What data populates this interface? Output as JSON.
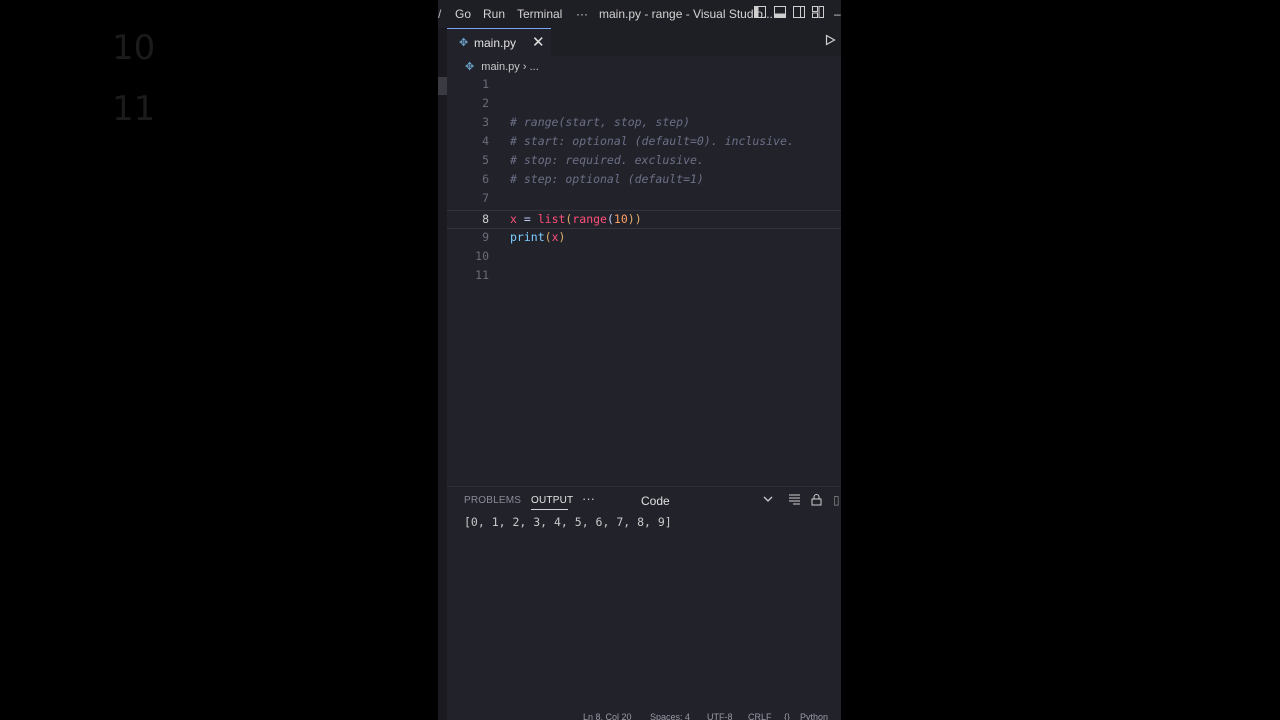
{
  "background": {
    "line_numbers": [
      "10",
      "11"
    ]
  },
  "titlebar": {
    "menu": [
      "Go",
      "Run",
      "Terminal"
    ],
    "more": "···",
    "title": "main.py - range - Visual Studio..."
  },
  "tab": {
    "icon": "python-icon",
    "name": "main.py",
    "close": "✕"
  },
  "breadcrumb": {
    "file": "main.py",
    "sep": "›",
    "rest": "..."
  },
  "editor": {
    "line_numbers": [
      "1",
      "2",
      "3",
      "4",
      "5",
      "6",
      "7",
      "8",
      "9",
      "10",
      "11"
    ],
    "comments": [
      "# range(start, stop, step)",
      "# start: optional (default=0). inclusive.",
      "# stop: required. exclusive.",
      "# step: optional (default=1)"
    ],
    "line8": {
      "var": "x",
      "assign": " = ",
      "list": "list",
      "open1": "(",
      "range": "range",
      "open2": "(",
      "num": "10",
      "close": "))"
    },
    "line9": {
      "print": "print",
      "open": "(",
      "arg": "x",
      "close": ")"
    }
  },
  "panel": {
    "tabs": [
      "PROBLEMS",
      "OUTPUT"
    ],
    "active_tab": "OUTPUT",
    "more": "···",
    "channel": "Code",
    "output": "[0, 1, 2, 3, 4, 5, 6, 7, 8, 9]"
  },
  "status": {
    "position": "Ln 8, Col 20",
    "spaces": "Spaces: 4",
    "encoding": "UTF-8",
    "eol": "CRLF",
    "braces": "{}",
    "language": "Python"
  },
  "colors": {
    "editor_bg": "#22222b",
    "comment": "#6c7086",
    "keyword_pink": "#ff4f78",
    "number": "#ff9e64",
    "accent": "#7aa2f7"
  }
}
